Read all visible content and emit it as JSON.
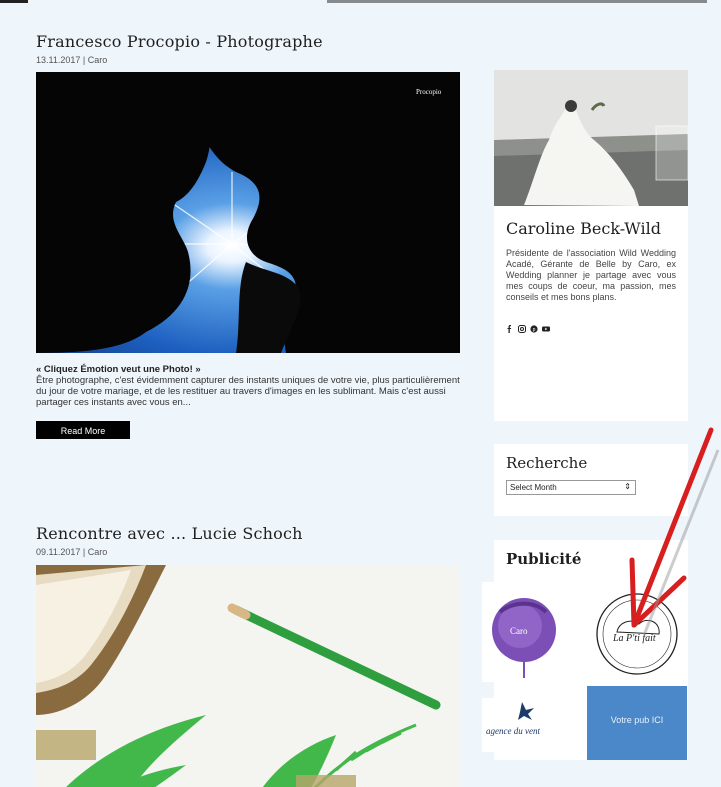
{
  "posts": [
    {
      "title": "Francesco Procopio - Photographe",
      "meta": "13.11.2017 | Caro",
      "image": "couple-silhouette-sunburst-photo",
      "excerpt_quote": "« Cliquez Émotion veut une Photo! »",
      "excerpt_text": "Être photographe, c'est évidemment capturer des instants uniques de votre vie, plus particulièrement du jour de votre mariage, et de les restituer au travers d'images en les sublimant. Mais c'est aussi partager ces instants avec vous en...",
      "read_more": "Read More"
    },
    {
      "title": "Rencontre avec ... Lucie Schoch",
      "meta": "09.11.2017 | Caro",
      "image": "book-pencil-fern-illustration"
    }
  ],
  "sidebar": {
    "profile": {
      "image": "bride-in-field-photo",
      "name": "Caroline Beck-Wild",
      "bio": "Présidente de l'association Wild Wedding Acadé, Gérante de Belle by Caro, ex Wedding planner je partage avec vous mes coups de coeur, ma passion, mes conseils et mes bons plans.",
      "social_icons": [
        "facebook-icon",
        "instagram-icon",
        "pinterest-icon",
        "youtube-icon"
      ]
    },
    "search": {
      "title": "Recherche",
      "select_value": "Select Month"
    },
    "ads": {
      "title": "Publicité",
      "items": [
        {
          "name": "caro-logo-ad",
          "text": "Caro"
        },
        {
          "name": "la-pti-fait-ad",
          "text": "La P'ti fait"
        },
        {
          "name": "agence-ad",
          "text": "agence du vent"
        },
        {
          "name": "votre-pub-ad",
          "text": "Votre pub ICI"
        }
      ]
    }
  },
  "colors": {
    "background": "#eef5fb",
    "accent_arrow": "#d81f1f",
    "ad_blue": "#4a88c9"
  }
}
